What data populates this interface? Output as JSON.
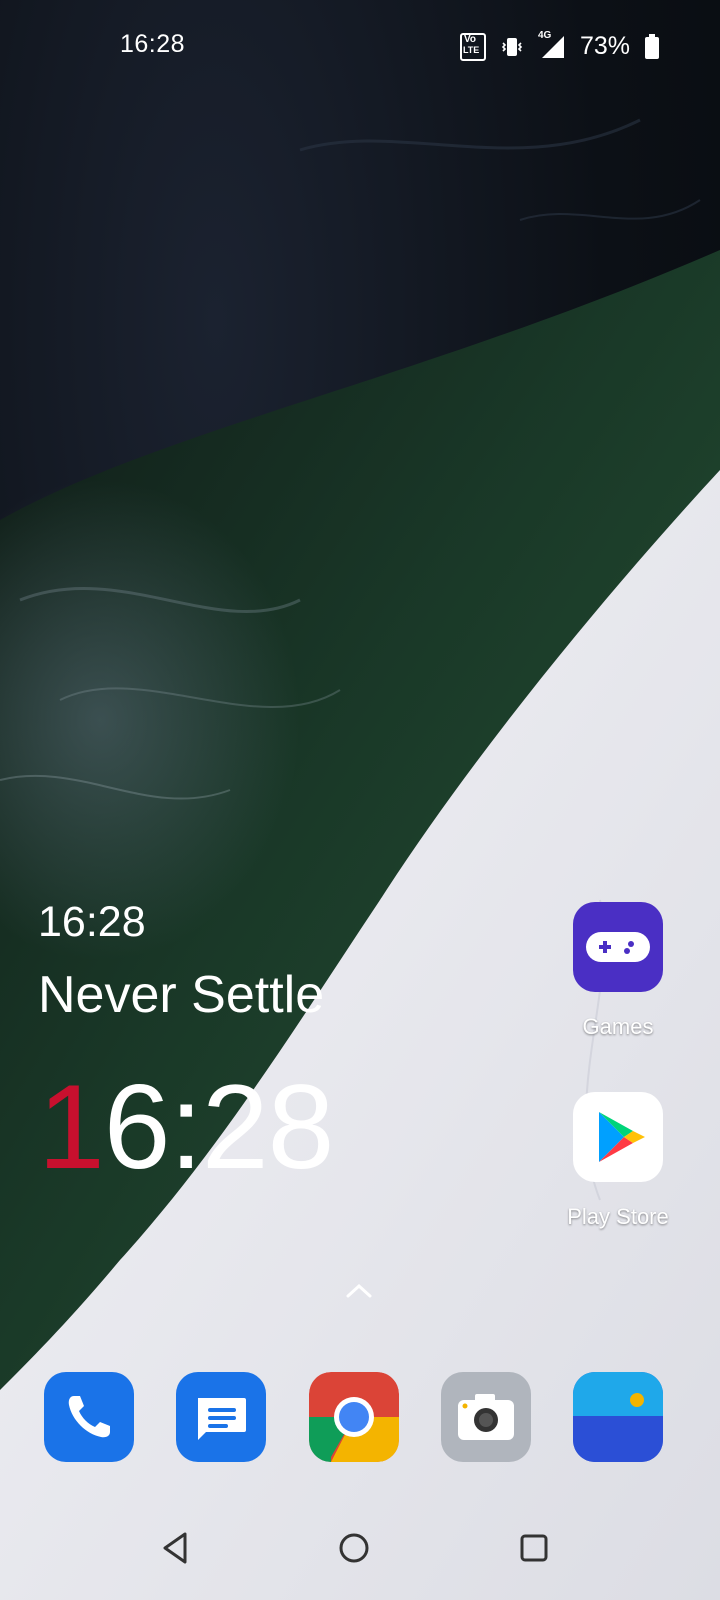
{
  "status_bar": {
    "time": "16:28",
    "volte_top": "Vo",
    "volte_bottom": "LTE",
    "network_type": "4G",
    "battery_percent": "73%",
    "icons": [
      "volte-icon",
      "vibrate-icon",
      "signal-icon",
      "battery-icon"
    ]
  },
  "clock_widget": {
    "time_small": "16:28",
    "tagline": "Never Settle",
    "time_big_first": "1",
    "time_big_rest": "6:28",
    "accent_color": "#c8102e"
  },
  "apps": [
    {
      "label": "Games",
      "icon": "games-controller-icon",
      "color": "#4a2fc4"
    },
    {
      "label": "Play Store",
      "icon": "play-store-icon",
      "color": "#ffffff"
    }
  ],
  "dock": [
    {
      "name": "phone",
      "icon": "phone-icon",
      "color": "#1a73e8"
    },
    {
      "name": "messages",
      "icon": "messages-icon",
      "color": "#1a73e8"
    },
    {
      "name": "chrome",
      "icon": "chrome-icon"
    },
    {
      "name": "camera",
      "icon": "camera-icon",
      "color": "#b0b5bd"
    },
    {
      "name": "gallery",
      "icon": "gallery-icon",
      "color": "#2b4fd6"
    }
  ],
  "nav": {
    "buttons": [
      "back-icon",
      "home-icon",
      "recents-icon"
    ]
  }
}
